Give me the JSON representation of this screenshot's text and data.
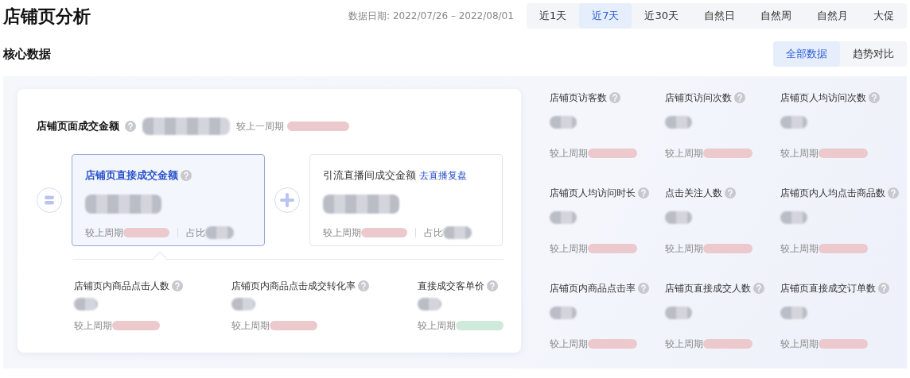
{
  "header": {
    "title": "店铺页分析",
    "date_label": "数据日期:  2022/07/26 – 2022/08/01",
    "ranges": [
      {
        "label": "近1天",
        "selected": false
      },
      {
        "label": "近7天",
        "selected": true
      },
      {
        "label": "近30天",
        "selected": false
      },
      {
        "label": "自然日",
        "selected": false
      },
      {
        "label": "自然周",
        "selected": false
      },
      {
        "label": "自然月",
        "selected": false
      },
      {
        "label": "大促",
        "selected": false
      }
    ]
  },
  "section": {
    "title": "核心数据",
    "views": [
      {
        "label": "全部数据",
        "selected": true
      },
      {
        "label": "趋势对比",
        "selected": false
      }
    ]
  },
  "total": {
    "label": "店铺页面成交金额",
    "compare_label": "较上一周期",
    "color": "#ecc9cd"
  },
  "parts": [
    {
      "title": "店铺页直接成交金额",
      "selected": true,
      "compare_label": "较上周期",
      "share_label": "占比",
      "color": "#ecc9cd"
    },
    {
      "title": "引流直播间成交金额",
      "link": "去直播复盘",
      "selected": false,
      "compare_label": "较上周期",
      "share_label": "占比",
      "color": "#ecc9cd"
    }
  ],
  "sub_metrics": [
    {
      "title": "店铺页内商品点击人数",
      "compare_label": "较上周期",
      "color": "#ecc9cd"
    },
    {
      "title": "店铺页内商品点击成交转化率",
      "compare_label": "较上周期",
      "color": "#ecc9cd"
    },
    {
      "title": "直接成交客单价",
      "compare_label": "较上周期",
      "color": "#cfeadb"
    }
  ],
  "metrics": [
    {
      "title": "店铺页访客数",
      "compare_label": "较上周期",
      "color": "#ecc9cd"
    },
    {
      "title": "店铺页访问次数",
      "compare_label": "较上周期",
      "color": "#ecc9cd"
    },
    {
      "title": "店铺页人均访问次数",
      "compare_label": "较上周期",
      "color": "#ecc9cd"
    },
    {
      "title": "店铺页人均访问时长",
      "compare_label": "较上周期",
      "color": "#ecc9cd"
    },
    {
      "title": "点击关注人数",
      "compare_label": "较上周期",
      "color": "#ecc9cd"
    },
    {
      "title": "店铺页内人均点击商品数",
      "compare_label": "较上周期",
      "color": "#ecc9cd"
    },
    {
      "title": "店铺页内商品点击率",
      "compare_label": "较上周期",
      "color": "#ecc9cd"
    },
    {
      "title": "店铺页直接成交人数",
      "compare_label": "较上周期",
      "color": "#ecc9cd"
    },
    {
      "title": "店铺页直接成交订单数",
      "compare_label": "较上周期",
      "color": "#ecc9cd"
    }
  ]
}
